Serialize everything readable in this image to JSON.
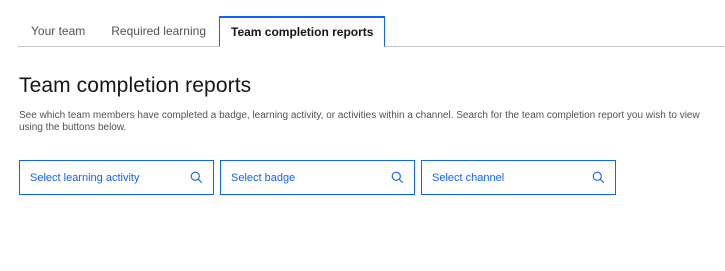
{
  "tabs": [
    {
      "label": "Your team",
      "active": false
    },
    {
      "label": "Required learning",
      "active": false
    },
    {
      "label": "Team completion reports",
      "active": true
    }
  ],
  "page": {
    "title": "Team completion reports",
    "description": "See which team members have completed a badge, learning activity, or activities within a channel. Search for the team completion report you wish to view using the buttons below."
  },
  "selectors": [
    {
      "label": "Select learning activity",
      "icon": "search-icon"
    },
    {
      "label": "Select badge",
      "icon": "search-icon"
    },
    {
      "label": "Select channel",
      "icon": "search-icon"
    }
  ],
  "colors": {
    "accent": "#0f62fe",
    "text": "#161616",
    "secondary_text": "#525252",
    "border": "#c6c6c6"
  }
}
